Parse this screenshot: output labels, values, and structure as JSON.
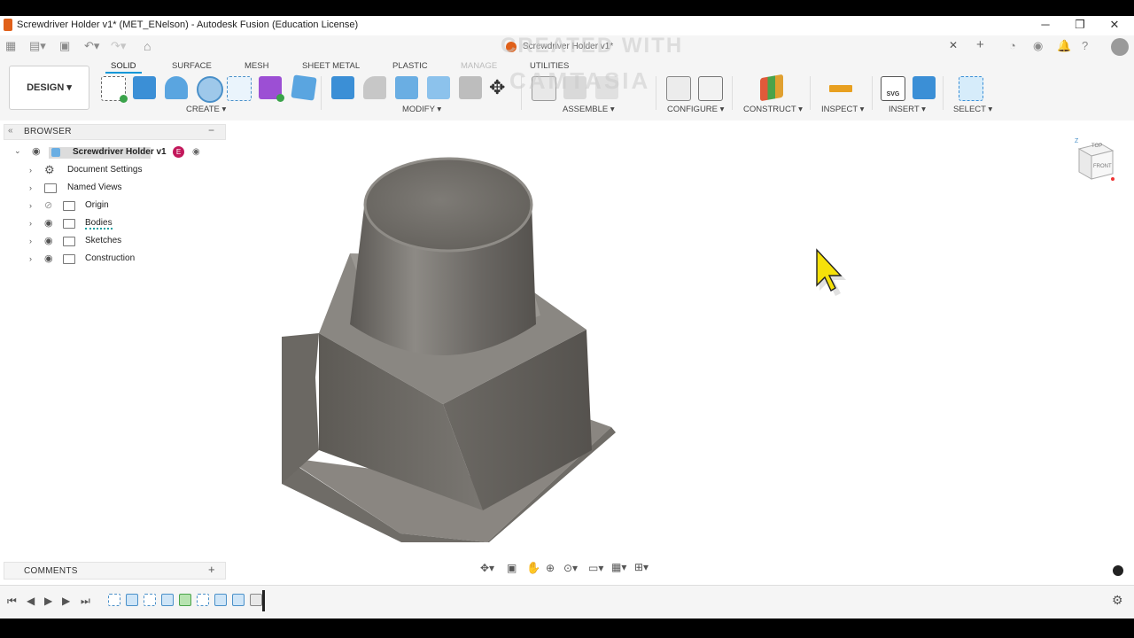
{
  "window": {
    "title": "Screwdriver Holder v1* (MET_ENelson) - Autodesk Fusion (Education License)",
    "minimize_glyph": "─",
    "restore_glyph": "❐",
    "close_glyph": "✕"
  },
  "document_tab": {
    "label": "Screwdriver Holder v1*"
  },
  "watermark": {
    "line1": "CREATED WITH",
    "line2": "CAMTASIA"
  },
  "workspace": {
    "label": "DESIGN ▾"
  },
  "ribbon": {
    "tabs": [
      "SOLID",
      "SURFACE",
      "MESH",
      "SHEET METAL",
      "PLASTIC",
      "MANAGE",
      "UTILITIES"
    ],
    "active_tab": "SOLID",
    "groups": [
      "CREATE ▾",
      "MODIFY ▾",
      "ASSEMBLE ▾",
      "CONFIGURE ▾",
      "CONSTRUCT ▾",
      "INSPECT ▾",
      "INSERT ▾",
      "SELECT ▾"
    ]
  },
  "browser": {
    "header": "BROWSER",
    "root": "Screwdriver Holder v1",
    "items": [
      "Document Settings",
      "Named Views",
      "Origin",
      "Bodies",
      "Sketches",
      "Construction"
    ]
  },
  "viewcube": {
    "top": "TOP",
    "front": "FRONT",
    "axis": "Z"
  },
  "comments": {
    "header": "COMMENTS"
  },
  "colors": {
    "accent": "#0696d7",
    "model": "#6e6b66",
    "cursor": "#f5e10a",
    "badge": "#c2185b"
  },
  "icons": [
    "apps-icon",
    "file-icon",
    "save-icon",
    "undo-icon",
    "redo-icon",
    "home-icon",
    "add-tab-icon",
    "job-status-icon",
    "extensions-icon",
    "notifications-icon",
    "help-icon",
    "user-avatar-icon",
    "orbit-icon",
    "pan-icon",
    "zoom-icon",
    "display-settings-icon",
    "grid-icon",
    "settings-icon"
  ]
}
